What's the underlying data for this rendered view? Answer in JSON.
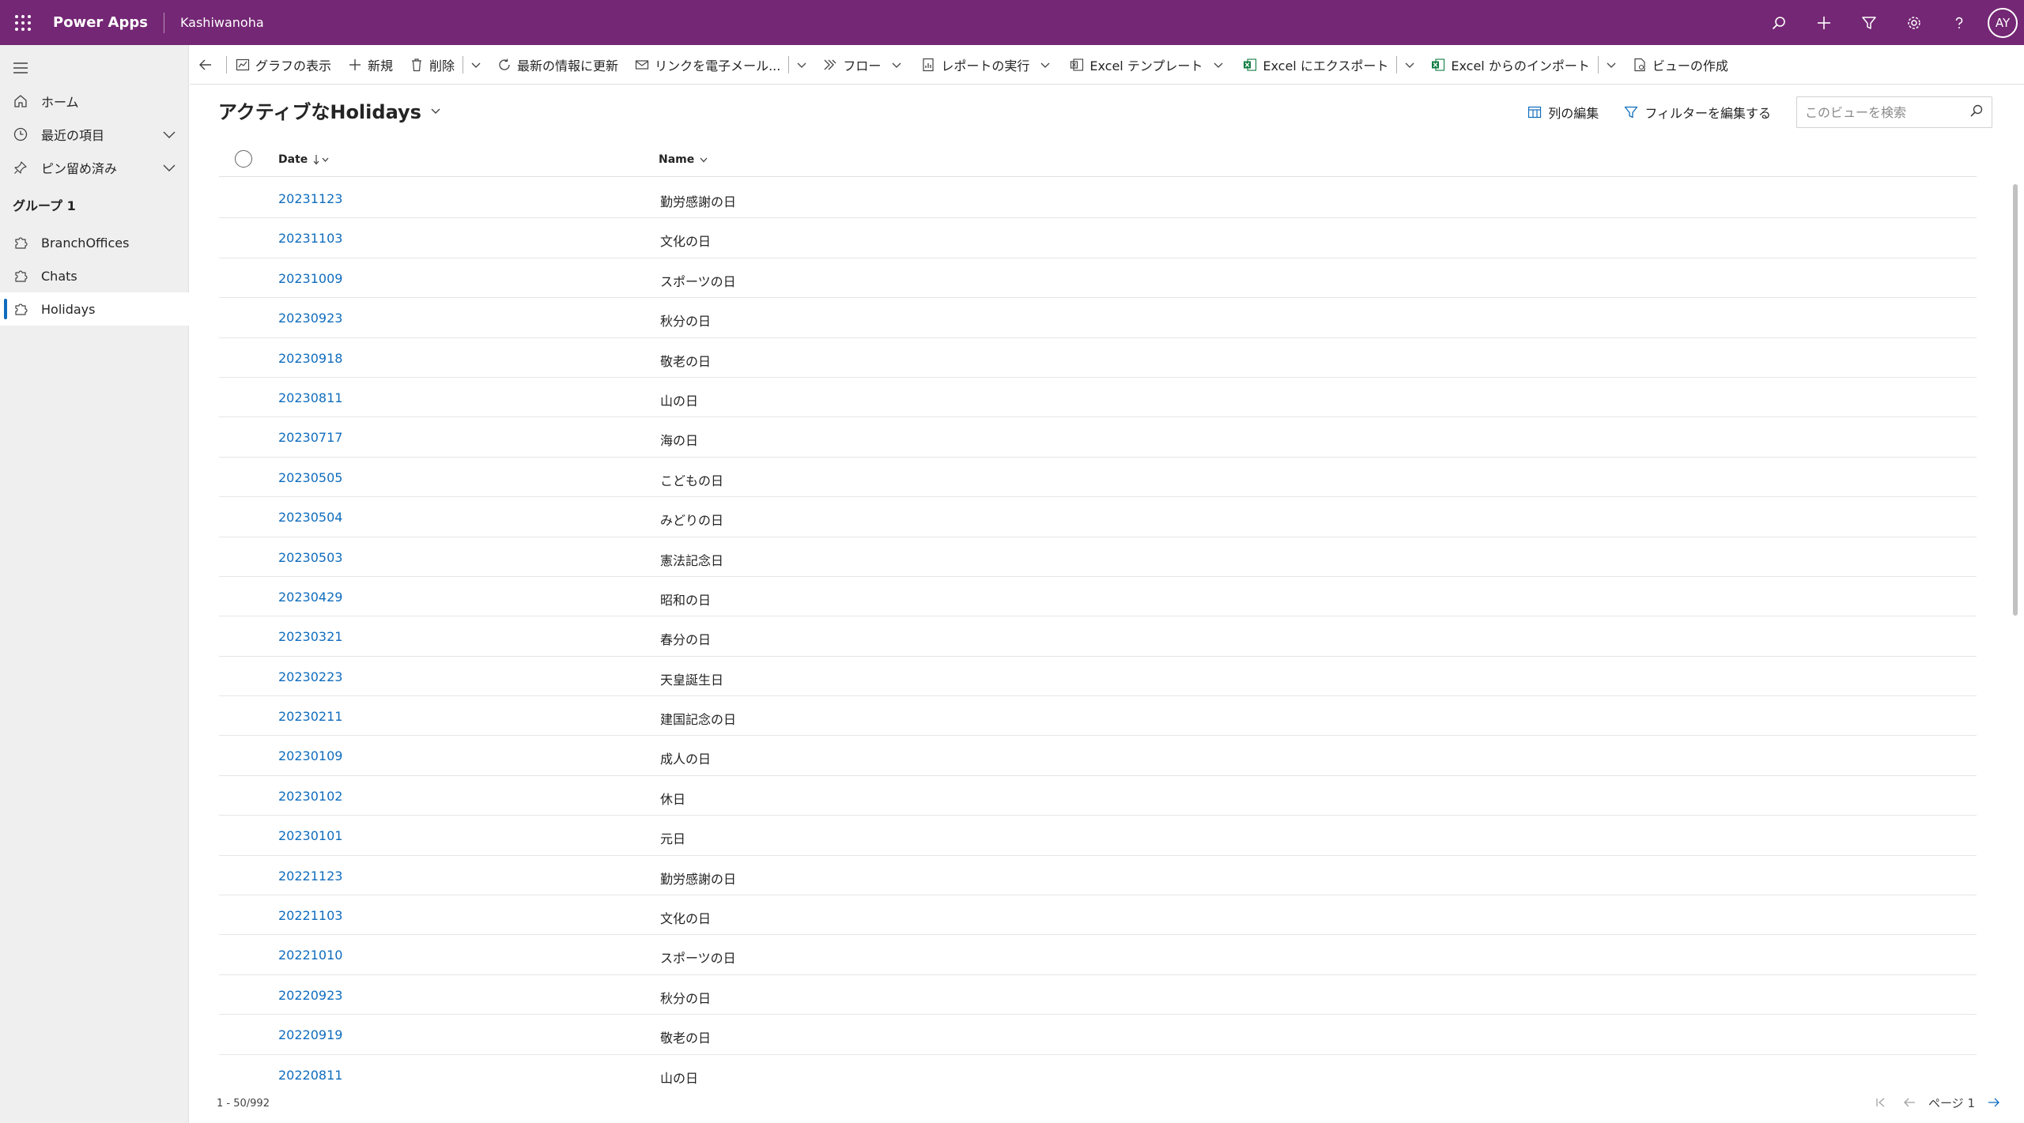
{
  "topbar": {
    "app_name": "Power Apps",
    "environment": "Kashiwanoha",
    "icons": [
      "search-icon",
      "plus-icon",
      "filter-icon",
      "settings-icon",
      "help-icon"
    ],
    "avatar_initials": "AY",
    "brand_color": "#742774"
  },
  "sidebar": {
    "items": [
      {
        "label": "ホーム",
        "icon": "home-icon"
      },
      {
        "label": "最近の項目",
        "icon": "clock-icon"
      },
      {
        "label": "ピン留め済み",
        "icon": "pin-icon"
      }
    ],
    "group_title": "グループ 1",
    "group_items": [
      {
        "label": "BranchOffices",
        "icon": "puzzle-icon"
      },
      {
        "label": "Chats",
        "icon": "puzzle-icon"
      },
      {
        "label": "Holidays",
        "icon": "puzzle-icon",
        "selected": true
      }
    ]
  },
  "commandbar": {
    "show_chart": "グラフの表示",
    "new": "新規",
    "delete": "削除",
    "refresh": "最新の情報に更新",
    "email_link": "リンクを電子メール...",
    "flow": "フロー",
    "run_report": "レポートの実行",
    "excel_template": "Excel テンプレート",
    "export_excel": "Excel にエクスポート",
    "import_excel": "Excel からのインポート",
    "create_view": "ビューの作成"
  },
  "view": {
    "title": "アクティブなHolidays",
    "edit_columns": "列の編集",
    "edit_filters": "フィルターを編集する",
    "search_placeholder": "このビューを検索"
  },
  "grid": {
    "columns": {
      "date": "Date",
      "name": "Name"
    },
    "rows": [
      {
        "date": "20231123",
        "name": "勤労感謝の日"
      },
      {
        "date": "20231103",
        "name": "文化の日"
      },
      {
        "date": "20231009",
        "name": "スポーツの日"
      },
      {
        "date": "20230923",
        "name": "秋分の日"
      },
      {
        "date": "20230918",
        "name": "敬老の日"
      },
      {
        "date": "20230811",
        "name": "山の日"
      },
      {
        "date": "20230717",
        "name": "海の日"
      },
      {
        "date": "20230505",
        "name": "こどもの日"
      },
      {
        "date": "20230504",
        "name": "みどりの日"
      },
      {
        "date": "20230503",
        "name": "憲法記念日"
      },
      {
        "date": "20230429",
        "name": "昭和の日"
      },
      {
        "date": "20230321",
        "name": "春分の日"
      },
      {
        "date": "20230223",
        "name": "天皇誕生日"
      },
      {
        "date": "20230211",
        "name": "建国記念の日"
      },
      {
        "date": "20230109",
        "name": "成人の日"
      },
      {
        "date": "20230102",
        "name": "休日"
      },
      {
        "date": "20230101",
        "name": "元日"
      },
      {
        "date": "20221123",
        "name": "勤労感謝の日"
      },
      {
        "date": "20221103",
        "name": "文化の日"
      },
      {
        "date": "20221010",
        "name": "スポーツの日"
      },
      {
        "date": "20220923",
        "name": "秋分の日"
      },
      {
        "date": "20220919",
        "name": "敬老の日"
      },
      {
        "date": "20220811",
        "name": "山の日"
      }
    ]
  },
  "footer": {
    "record_count": "1 - 50/992",
    "page_label": "ページ 1"
  },
  "colors": {
    "link": "#0f6cbd",
    "excel_green": "#107c41"
  }
}
